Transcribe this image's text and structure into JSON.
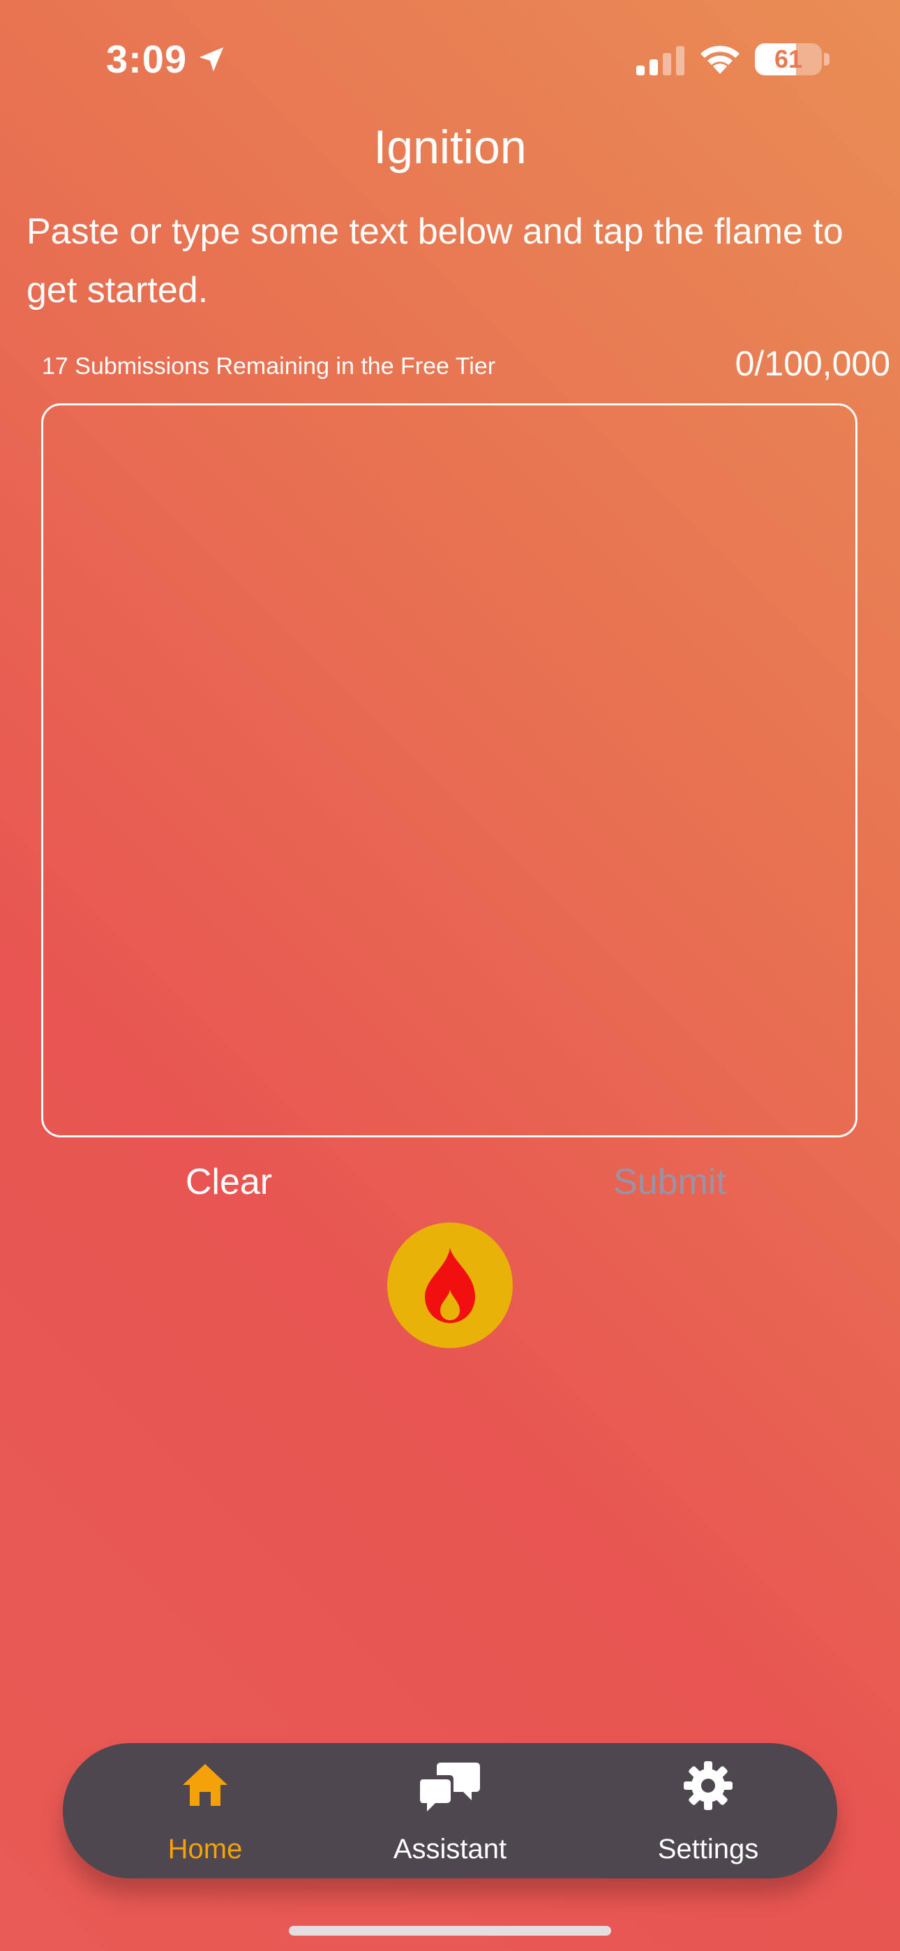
{
  "status_bar": {
    "time": "3:09",
    "battery_level": 61,
    "battery_label": "61",
    "location_icon": "location-arrow-icon",
    "signal_icon": "cellular-signal-icon",
    "wifi_icon": "wifi-icon"
  },
  "header": {
    "title": "Ignition"
  },
  "main": {
    "instructions": "Paste or type some text below and tap the flame to get started.",
    "remaining_label": "17 Submissions Remaining in the Free Tier",
    "char_counter": "0/100,000",
    "text_input_value": "",
    "clear_label": "Clear",
    "submit_label": "Submit",
    "flame_icon": "flame-icon"
  },
  "tab_bar": {
    "items": [
      {
        "label": "Home",
        "icon": "house-icon",
        "active": true
      },
      {
        "label": "Assistant",
        "icon": "chat-bubbles-icon",
        "active": false
      },
      {
        "label": "Settings",
        "icon": "gear-icon",
        "active": false
      }
    ]
  },
  "colors": {
    "gradient_top": "#E98D55",
    "gradient_bottom": "#E85552",
    "flame_button": "#E8B208",
    "flame": "#F20F0F",
    "tab_bar": "#4E474F",
    "active_tab": "#F5A10A",
    "disabled_submit": "#9A93A8"
  }
}
